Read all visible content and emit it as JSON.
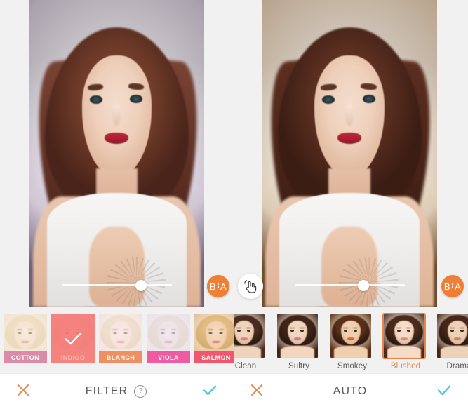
{
  "app": {
    "name": "photo-editor",
    "accent_orange": "#ef7f34",
    "accent_cyan": "#3fc8d8",
    "panel_background": "#f2f1f1"
  },
  "panels": [
    {
      "id": "filter-panel",
      "photo_alt": "portrait-photo-woman-white-top",
      "slider": {
        "name": "intensity-slider",
        "value_percent": 72,
        "min": 0,
        "max": 100
      },
      "compare_button": {
        "label_before": "B",
        "label_after": "A",
        "name": "before-after-compare"
      },
      "hand_button": null,
      "thumbnails": [
        {
          "label": "COTTON",
          "selected": false,
          "pill_color": "#d98ba9",
          "tint": "rgba(246,232,214,0.55)",
          "base": "light"
        },
        {
          "label": "INDIGO",
          "selected": true,
          "pill_color": "#f4837e",
          "tint": "rgba(244,122,120,0.92)",
          "base": "light"
        },
        {
          "label": "BLANCH",
          "selected": false,
          "pill_color": "#ef8f62",
          "tint": "rgba(248,231,233,0.55)",
          "base": "light"
        },
        {
          "label": "VIOLA",
          "selected": false,
          "pill_color": "#ef5ba0",
          "tint": "rgba(233,228,246,0.60)",
          "base": "light"
        },
        {
          "label": "SALMON",
          "selected": false,
          "pill_color": "#f0566c",
          "tint": "rgba(255,214,190,0.18)",
          "base": "warm"
        }
      ],
      "bottom_bar": {
        "title": "FILTER",
        "has_help": true,
        "help_glyph": "?",
        "cancel": "cancel-x",
        "confirm": "confirm-check"
      }
    },
    {
      "id": "auto-panel",
      "photo_alt": "portrait-photo-woman-warm-tone",
      "slider": {
        "name": "intensity-slider",
        "value_percent": 62,
        "min": 0,
        "max": 100
      },
      "compare_button": {
        "label_before": "B",
        "label_after": "A",
        "name": "before-after-compare"
      },
      "hand_button": {
        "name": "touch-gesture-button",
        "icon": "hand-tap-icon"
      },
      "thumbnails": [
        {
          "label": "Clean",
          "selected": false,
          "skin": "#f0d3bb",
          "hair": "#4a2c1e",
          "lip": "#e4798a",
          "bgc": "#f4e6da"
        },
        {
          "label": "Sultry",
          "selected": false,
          "skin": "#f2d6bd",
          "hair": "#3f2418",
          "lip": "#c27c9a",
          "bgc": "#f2e3d4"
        },
        {
          "label": "Smokey",
          "selected": false,
          "skin": "#f0cfae",
          "hair": "#5a2f19",
          "lip": "#e2622b",
          "bgc": "#f0dfc8"
        },
        {
          "label": "Blushed",
          "selected": true,
          "skin": "#f6dcc8",
          "hair": "#4a2a1a",
          "lip": "#d98a90",
          "bgc": "#f7e9dd"
        },
        {
          "label": "Drama",
          "selected": false,
          "skin": "#eed2b7",
          "hair": "#452618",
          "lip": "#c98472",
          "bgc": "#f1e2d2"
        }
      ],
      "bottom_bar": {
        "title": "AUTO",
        "has_help": false,
        "help_glyph": "",
        "cancel": "cancel-x",
        "confirm": "confirm-check"
      }
    }
  ]
}
